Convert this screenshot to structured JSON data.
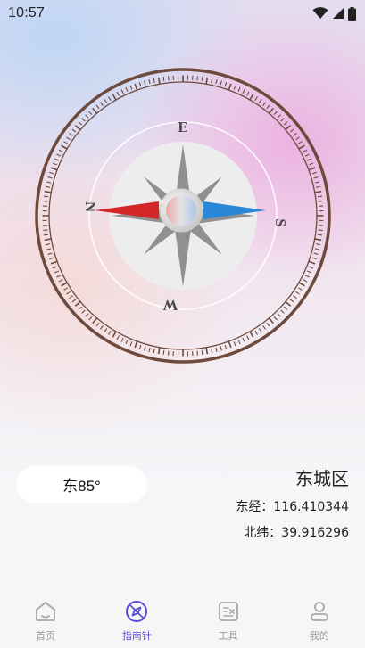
{
  "status_bar": {
    "time": "10:57",
    "icons": [
      "wifi-icon",
      "cellular-signal-icon",
      "battery-icon"
    ]
  },
  "compass": {
    "heading_degrees": 85,
    "dial_letters": {
      "north": "N",
      "east": "E",
      "south": "S",
      "west": "W"
    },
    "needle_colors": {
      "north": "#d32626",
      "south": "#2a86d6"
    }
  },
  "direction_display": "东85°",
  "location": {
    "district": "东城区",
    "longitude": "东经：116.410344",
    "latitude": "北纬：39.916296"
  },
  "bottom_nav": {
    "active_index": 1,
    "active_color": "#5a4bd6",
    "items": [
      {
        "label": "首页",
        "icon": "home-icon"
      },
      {
        "label": "指南针",
        "icon": "compass-icon"
      },
      {
        "label": "工具",
        "icon": "tools-icon"
      },
      {
        "label": "我的",
        "icon": "profile-icon"
      }
    ]
  }
}
